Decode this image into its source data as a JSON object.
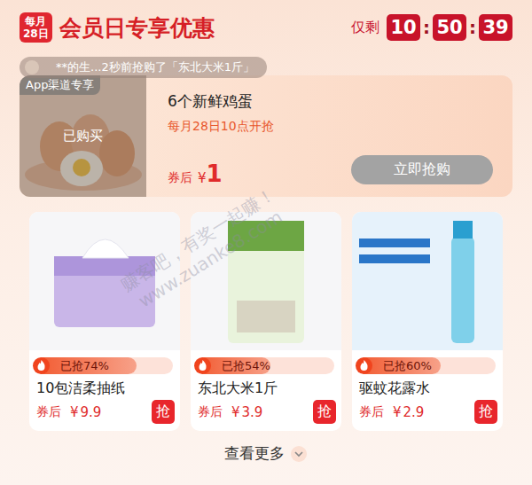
{
  "header": {
    "badge": [
      "每月",
      "28日"
    ],
    "title": "会员日专享优惠",
    "remain_label": "仅剩",
    "countdown": [
      "10",
      "50",
      "39"
    ],
    "separator": ":"
  },
  "ticker": "ゞ**的生...2秒前抢购了「东北大米1斤」",
  "featured": {
    "tag": "App渠道专享",
    "overlay": "已购买",
    "purchased": true,
    "title": "6个新鲜鸡蛋",
    "time": "每月28日10点开抢",
    "price_label": "券后",
    "currency": "¥",
    "price": "1",
    "button": "立即抢购",
    "button_greyed": true
  },
  "products": [
    {
      "name": "10包洁柔抽纸",
      "sold": "已抢74%",
      "level": 0.74,
      "price_label": "券后",
      "currency": "¥",
      "price": "9.9",
      "button": "抢"
    },
    {
      "name": "东北大米1斤",
      "sold": "已抢54%",
      "level": 0.54,
      "price_label": "券后",
      "currency": "¥",
      "price": "3.9",
      "button": "抢"
    },
    {
      "name": "驱蚊花露水",
      "sold": "已抢60%",
      "level": 0.6,
      "price_label": "券后",
      "currency": "¥",
      "price": "2.9",
      "button": "抢"
    }
  ],
  "more": "查看更多",
  "watermark": [
    "赚客吧，有奖一起赚！",
    "www.zuanke8.com"
  ]
}
